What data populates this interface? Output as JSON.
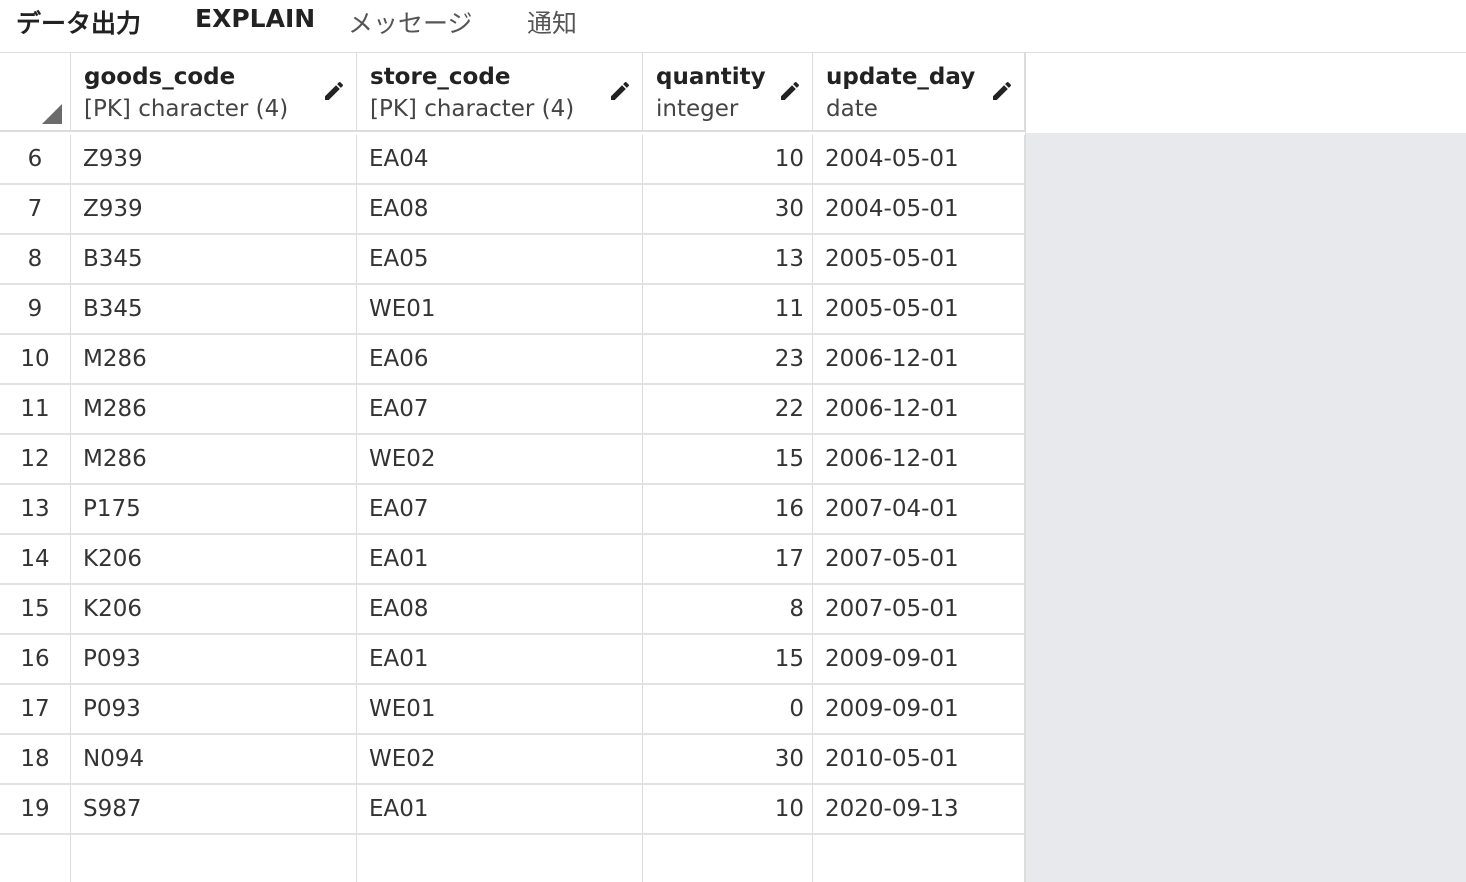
{
  "tabs": [
    {
      "label": "データ出力"
    },
    {
      "label": "EXPLAIN"
    },
    {
      "label": "メッセージ"
    },
    {
      "label": "通知"
    }
  ],
  "columns": [
    {
      "name": "goods_code",
      "type": "[PK] character (4)"
    },
    {
      "name": "store_code",
      "type": "[PK] character (4)"
    },
    {
      "name": "quantity",
      "type": "integer"
    },
    {
      "name": "update_day",
      "type": "date"
    }
  ],
  "rows": [
    {
      "n": "6",
      "goods_code": "Z939",
      "store_code": "EA04",
      "quantity": "10",
      "update_day": "2004-05-01"
    },
    {
      "n": "7",
      "goods_code": "Z939",
      "store_code": "EA08",
      "quantity": "30",
      "update_day": "2004-05-01"
    },
    {
      "n": "8",
      "goods_code": "B345",
      "store_code": "EA05",
      "quantity": "13",
      "update_day": "2005-05-01"
    },
    {
      "n": "9",
      "goods_code": "B345",
      "store_code": "WE01",
      "quantity": "11",
      "update_day": "2005-05-01"
    },
    {
      "n": "10",
      "goods_code": "M286",
      "store_code": "EA06",
      "quantity": "23",
      "update_day": "2006-12-01"
    },
    {
      "n": "11",
      "goods_code": "M286",
      "store_code": "EA07",
      "quantity": "22",
      "update_day": "2006-12-01"
    },
    {
      "n": "12",
      "goods_code": "M286",
      "store_code": "WE02",
      "quantity": "15",
      "update_day": "2006-12-01"
    },
    {
      "n": "13",
      "goods_code": "P175",
      "store_code": "EA07",
      "quantity": "16",
      "update_day": "2007-04-01"
    },
    {
      "n": "14",
      "goods_code": "K206",
      "store_code": "EA01",
      "quantity": "17",
      "update_day": "2007-05-01"
    },
    {
      "n": "15",
      "goods_code": "K206",
      "store_code": "EA08",
      "quantity": "8",
      "update_day": "2007-05-01"
    },
    {
      "n": "16",
      "goods_code": "P093",
      "store_code": "EA01",
      "quantity": "15",
      "update_day": "2009-09-01"
    },
    {
      "n": "17",
      "goods_code": "P093",
      "store_code": "WE01",
      "quantity": "0",
      "update_day": "2009-09-01"
    },
    {
      "n": "18",
      "goods_code": "N094",
      "store_code": "WE02",
      "quantity": "30",
      "update_day": "2010-05-01"
    },
    {
      "n": "19",
      "goods_code": "S987",
      "store_code": "EA01",
      "quantity": "10",
      "update_day": "2020-09-13"
    },
    {
      "n": "",
      "goods_code": "",
      "store_code": "",
      "quantity": "",
      "update_day": ""
    }
  ],
  "icons": {
    "edit": "pencil-icon",
    "corner": "select-all-triangle-icon"
  }
}
